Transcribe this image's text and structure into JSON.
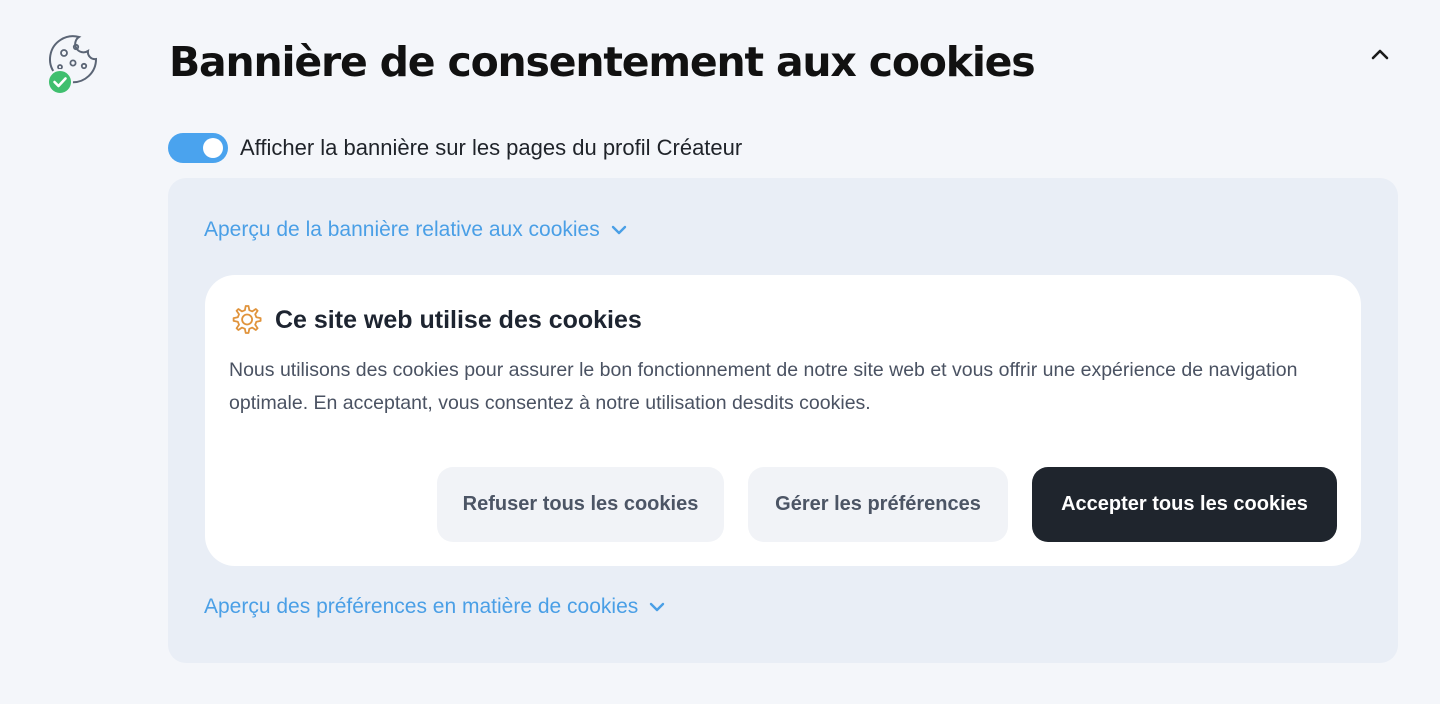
{
  "header": {
    "title": "Bannière de consentement aux cookies",
    "icon": "cookie-check-icon",
    "collapse_icon": "chevron-up-icon"
  },
  "toggle": {
    "label": "Afficher la bannière sur les pages du profil Créateur",
    "checked": true,
    "color": "#4aa3ee"
  },
  "preview": {
    "banner_toggle_label": "Aperçu de la bannière relative aux cookies",
    "preferences_toggle_label": "Aperçu des préférences en matière de cookies",
    "link_color": "#4a9fe6"
  },
  "banner": {
    "icon": "gear-icon",
    "title": "Ce site web utilise des cookies",
    "text": "Nous utilisons des cookies pour assurer le bon fonctionnement de notre site web et vous offrir une expérience de navigation optimale. En acceptant, vous consentez à notre utilisation desdits cookies.",
    "buttons": {
      "refuse": "Refuser tous les cookies",
      "manage": "Gérer les préférences",
      "accept": "Accepter tous les cookies"
    },
    "accent_icon_color": "#e0933b",
    "accept_color": "#1f252d"
  }
}
